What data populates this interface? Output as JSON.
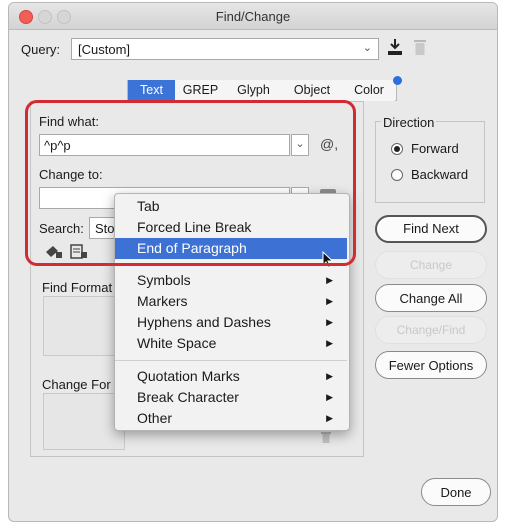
{
  "window": {
    "title": "Find/Change"
  },
  "query": {
    "label": "Query:",
    "value": "[Custom]"
  },
  "tabs": [
    {
      "label": "Text",
      "active": true
    },
    {
      "label": "GREP"
    },
    {
      "label": "Glyph"
    },
    {
      "label": "Object"
    },
    {
      "label": "Color"
    }
  ],
  "find": {
    "label": "Find what:",
    "value": "^p^p",
    "special_symbol": "@,"
  },
  "change": {
    "label": "Change to:",
    "value": ""
  },
  "search": {
    "label": "Search:",
    "value": "Sto"
  },
  "find_format": {
    "label": "Find Format"
  },
  "change_format": {
    "label": "Change For"
  },
  "direction": {
    "label": "Direction",
    "forward": "Forward",
    "backward": "Backward",
    "selected": "Forward"
  },
  "buttons": {
    "find_next": "Find Next",
    "change": "Change",
    "change_all": "Change All",
    "change_find": "Change/Find",
    "fewer_options": "Fewer Options",
    "done": "Done"
  },
  "menu": {
    "group1": [
      "Tab",
      "Forced Line Break",
      "End of Paragraph"
    ],
    "highlighted": "End of Paragraph",
    "group2": [
      {
        "label": "Symbols",
        "submenu": true
      },
      {
        "label": "Markers",
        "submenu": true
      },
      {
        "label": "Hyphens and Dashes",
        "submenu": true
      },
      {
        "label": "White Space",
        "submenu": true
      }
    ],
    "group3": [
      {
        "label": "Quotation Marks",
        "submenu": true
      },
      {
        "label": "Break Character",
        "submenu": true
      },
      {
        "label": "Other",
        "submenu": true
      }
    ]
  },
  "colors": {
    "highlight": "#3d72d4",
    "callout": "#d22b34",
    "accent_dot": "#2b6fe0"
  }
}
